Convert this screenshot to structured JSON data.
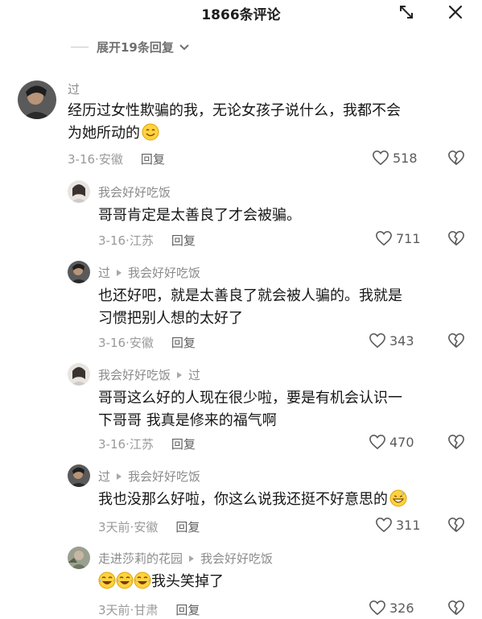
{
  "header": {
    "title": "1866条评论"
  },
  "expand_replies": {
    "label": "展开19条回复"
  },
  "comments": [
    {
      "author": "过",
      "text_lines": [
        "经历过女性欺骗的我，无论女孩子说什么，我都不会",
        "为她所动的"
      ],
      "date": "3-16",
      "location": "安徽",
      "reply_label": "回复",
      "likes": "518"
    },
    {
      "author": "我会好好吃饭",
      "text_lines": [
        "哥哥肯定是太善良了才会被骗。"
      ],
      "date": "3-16",
      "location": "江苏",
      "reply_label": "回复",
      "likes": "711"
    },
    {
      "author": "过",
      "reply_to": "我会好好吃饭",
      "text_lines": [
        "也还好吧，就是太善良了就会被人骗的。我就是",
        "习惯把别人想的太好了"
      ],
      "date": "3-16",
      "location": "安徽",
      "reply_label": "回复",
      "likes": "343"
    },
    {
      "author": "我会好好吃饭",
      "reply_to": "过",
      "text_lines": [
        "哥哥这么好的人现在很少啦，要是有机会认识一",
        "下哥哥 我真是修来的福气啊"
      ],
      "date": "3-16",
      "location": "江苏",
      "reply_label": "回复",
      "likes": "470"
    },
    {
      "author": "过",
      "reply_to": "我会好好吃饭",
      "text_lines": [
        "我也没那么好啦，你这么说我还挺不好意思的"
      ],
      "date": "3天前",
      "location": "安徽",
      "reply_label": "回复",
      "likes": "311"
    },
    {
      "author": "走进莎莉的花园",
      "reply_to": "我会好好吃饭",
      "text_lines": [
        "我头笑掉了"
      ],
      "date": "3天前",
      "location": "甘肃",
      "reply_label": "回复",
      "likes": "326"
    }
  ],
  "emoji_names": [
    "smile-emoji",
    "grin-sweat-emoji",
    "laugh-cry-emoji"
  ]
}
